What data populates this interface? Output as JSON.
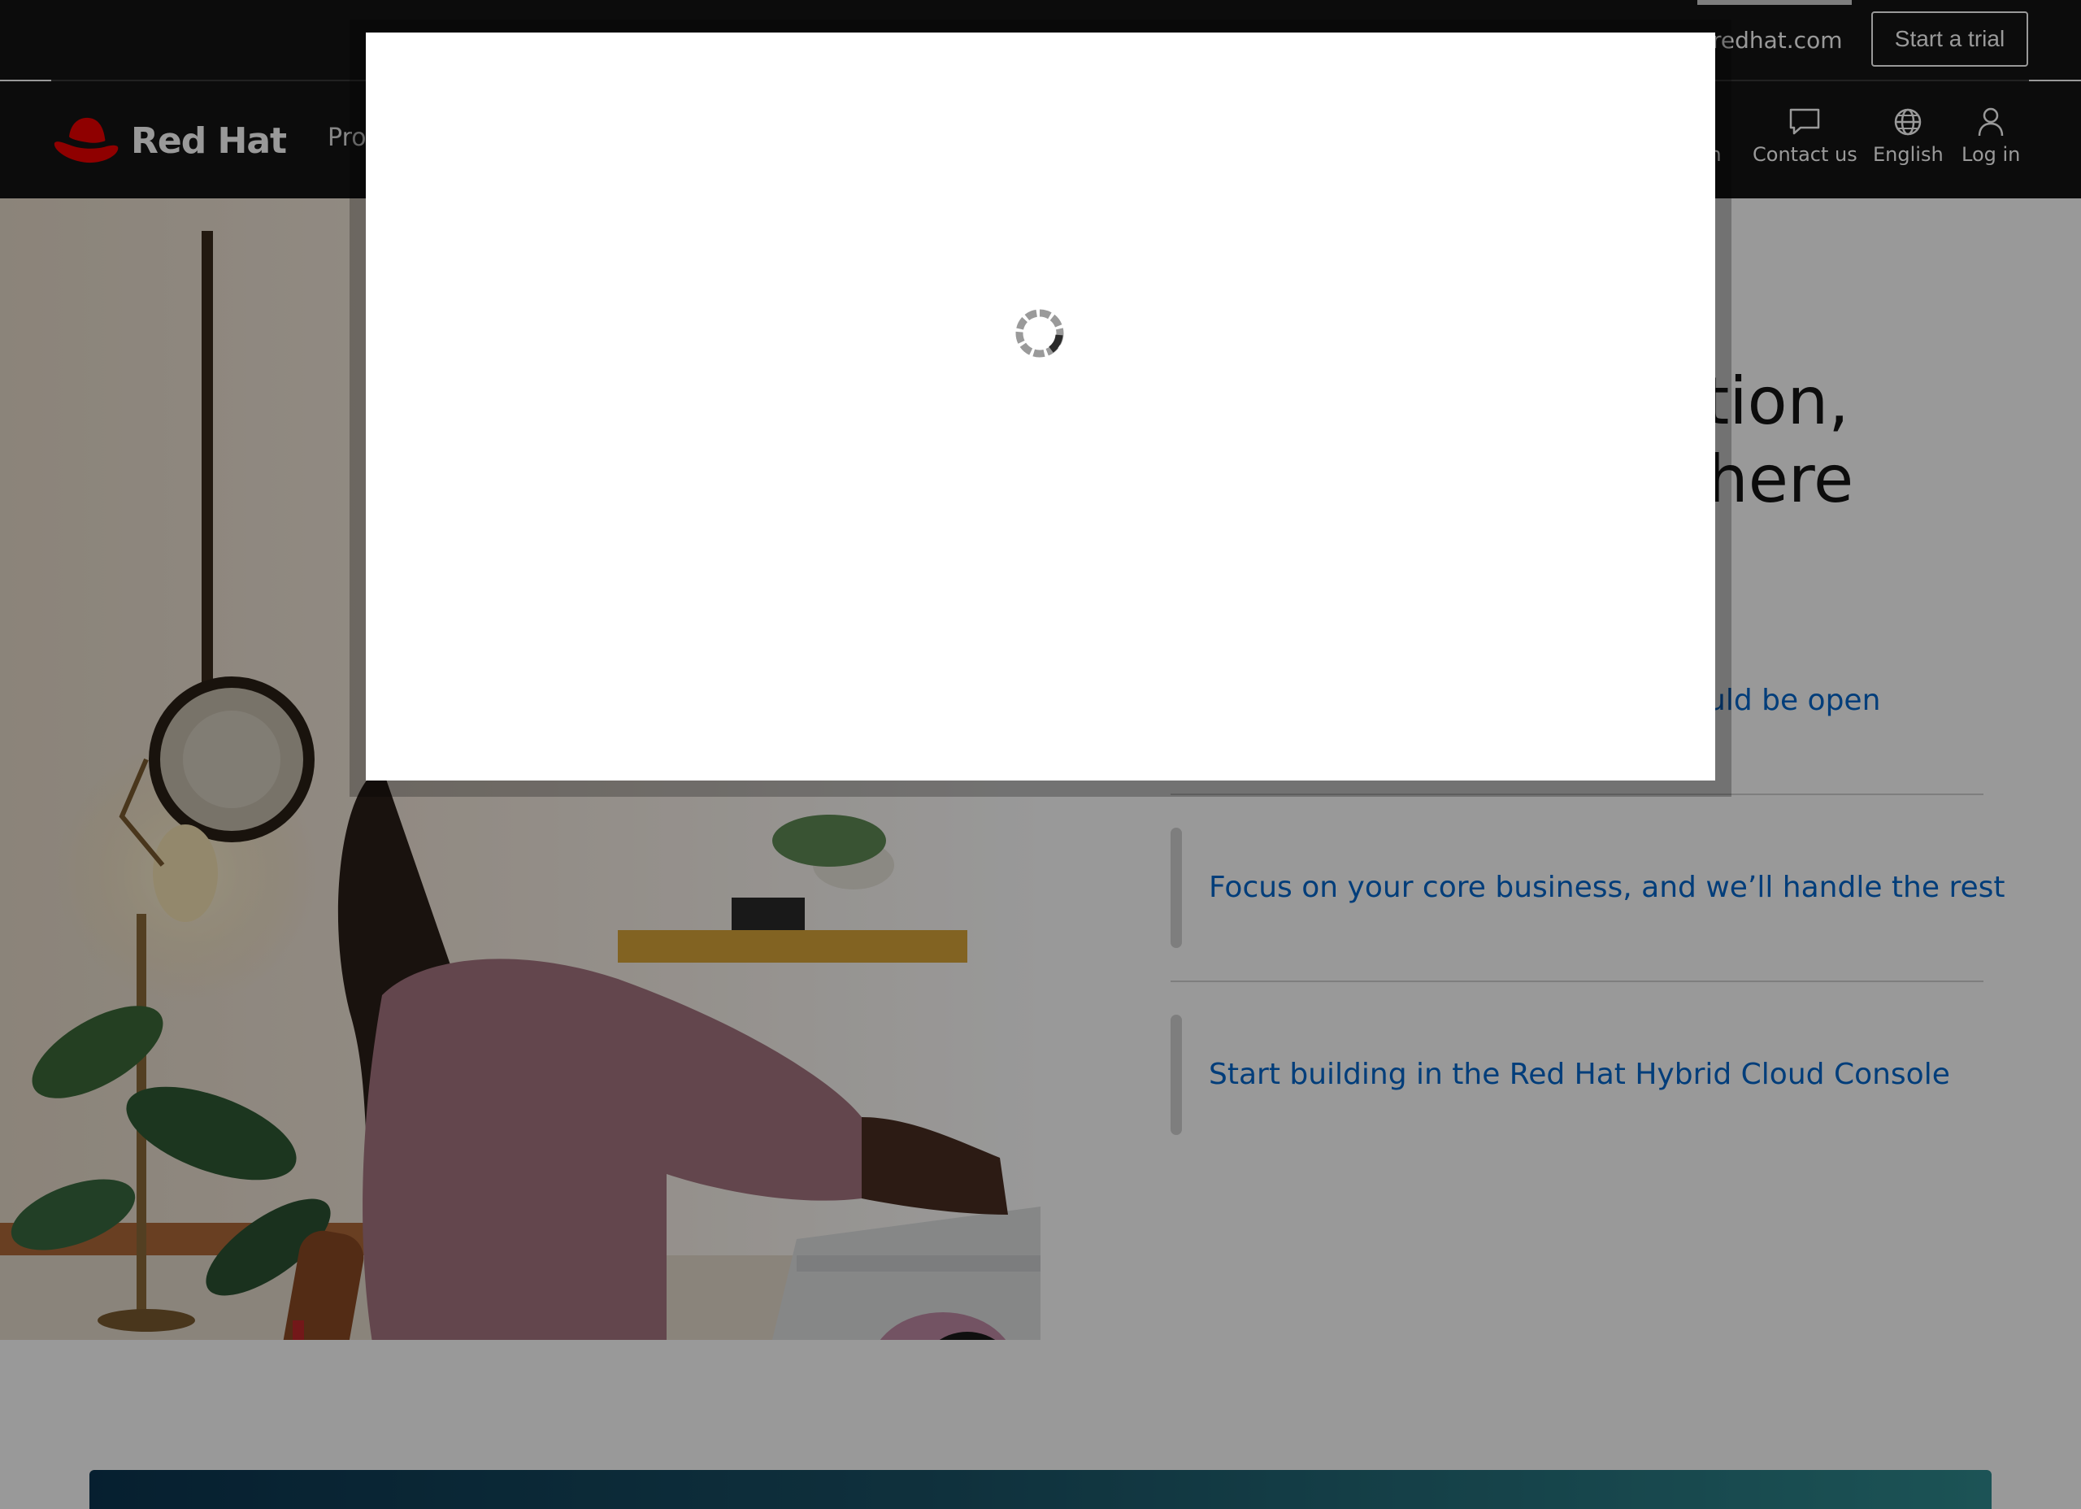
{
  "header": {
    "top_link": "redhat.com",
    "trial_button": "Start a trial",
    "brand": "Red Hat",
    "nav_products_partial": "Pro",
    "utility": {
      "search_partial": "h",
      "contact": "Contact us",
      "language": "English",
      "login": "Log in"
    }
  },
  "hero": {
    "heading_line1_partial": "tion,",
    "heading_line2_partial": "here",
    "links": [
      "uld be open",
      "Focus on your core business, and we’ll handle the rest",
      "Start building in the Red Hat Hybrid Cloud Console"
    ]
  },
  "modal": {
    "state": "loading"
  },
  "colors": {
    "header_bg": "#151515",
    "brand_red": "#ee0000",
    "link_blue": "#0066cc",
    "overlay": "rgba(0,0,0,0.4)"
  }
}
